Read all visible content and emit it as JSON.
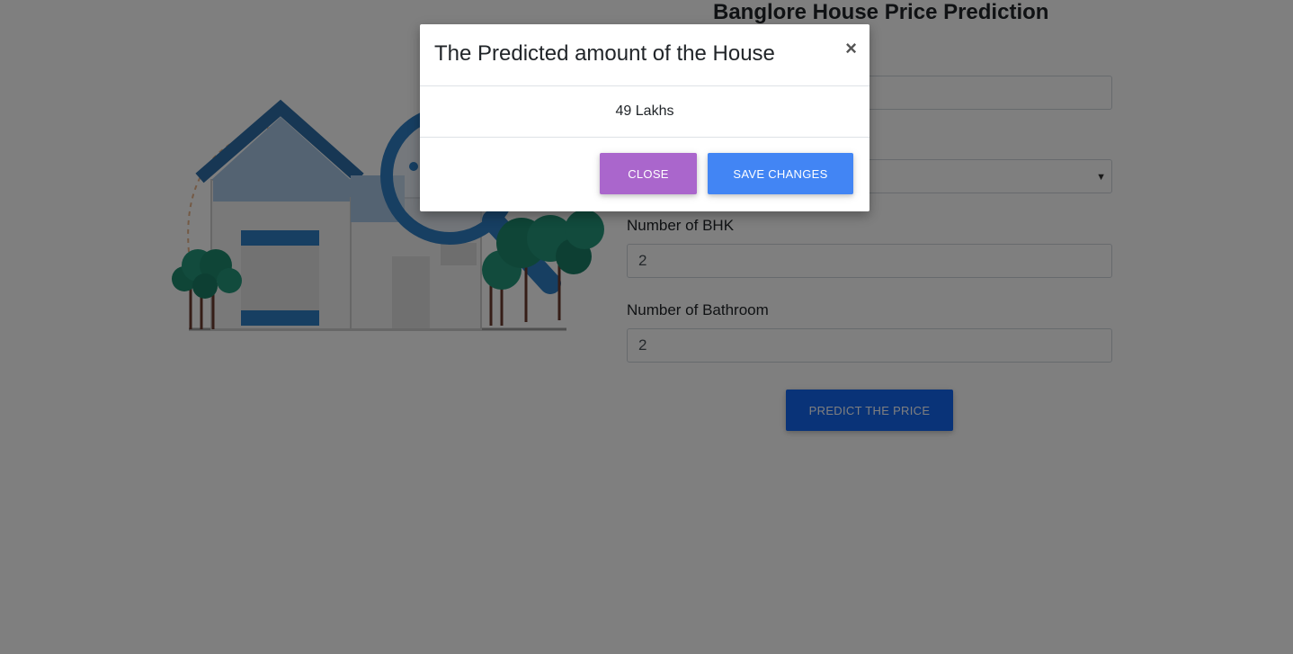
{
  "page": {
    "title": "Banglore House Price Prediction",
    "bhk_label": "Number of BHK",
    "bhk_value": "2",
    "bath_label": "Number of Bathroom",
    "bath_value": "2",
    "predict_button": "PREDICT THE PRICE"
  },
  "modal": {
    "title": "The Predicted amount of the House",
    "close_x": "×",
    "body": "49 Lakhs",
    "close_button": "CLOSE",
    "save_button": "SAVE CHANGES"
  },
  "colors": {
    "primary": "#1266f1",
    "save": "#4285f4",
    "close": "#aa66cc",
    "illustration_blue": "#2f6fa8"
  },
  "icons": {
    "close": "close-icon",
    "select_caret": "chevron-down-icon"
  }
}
